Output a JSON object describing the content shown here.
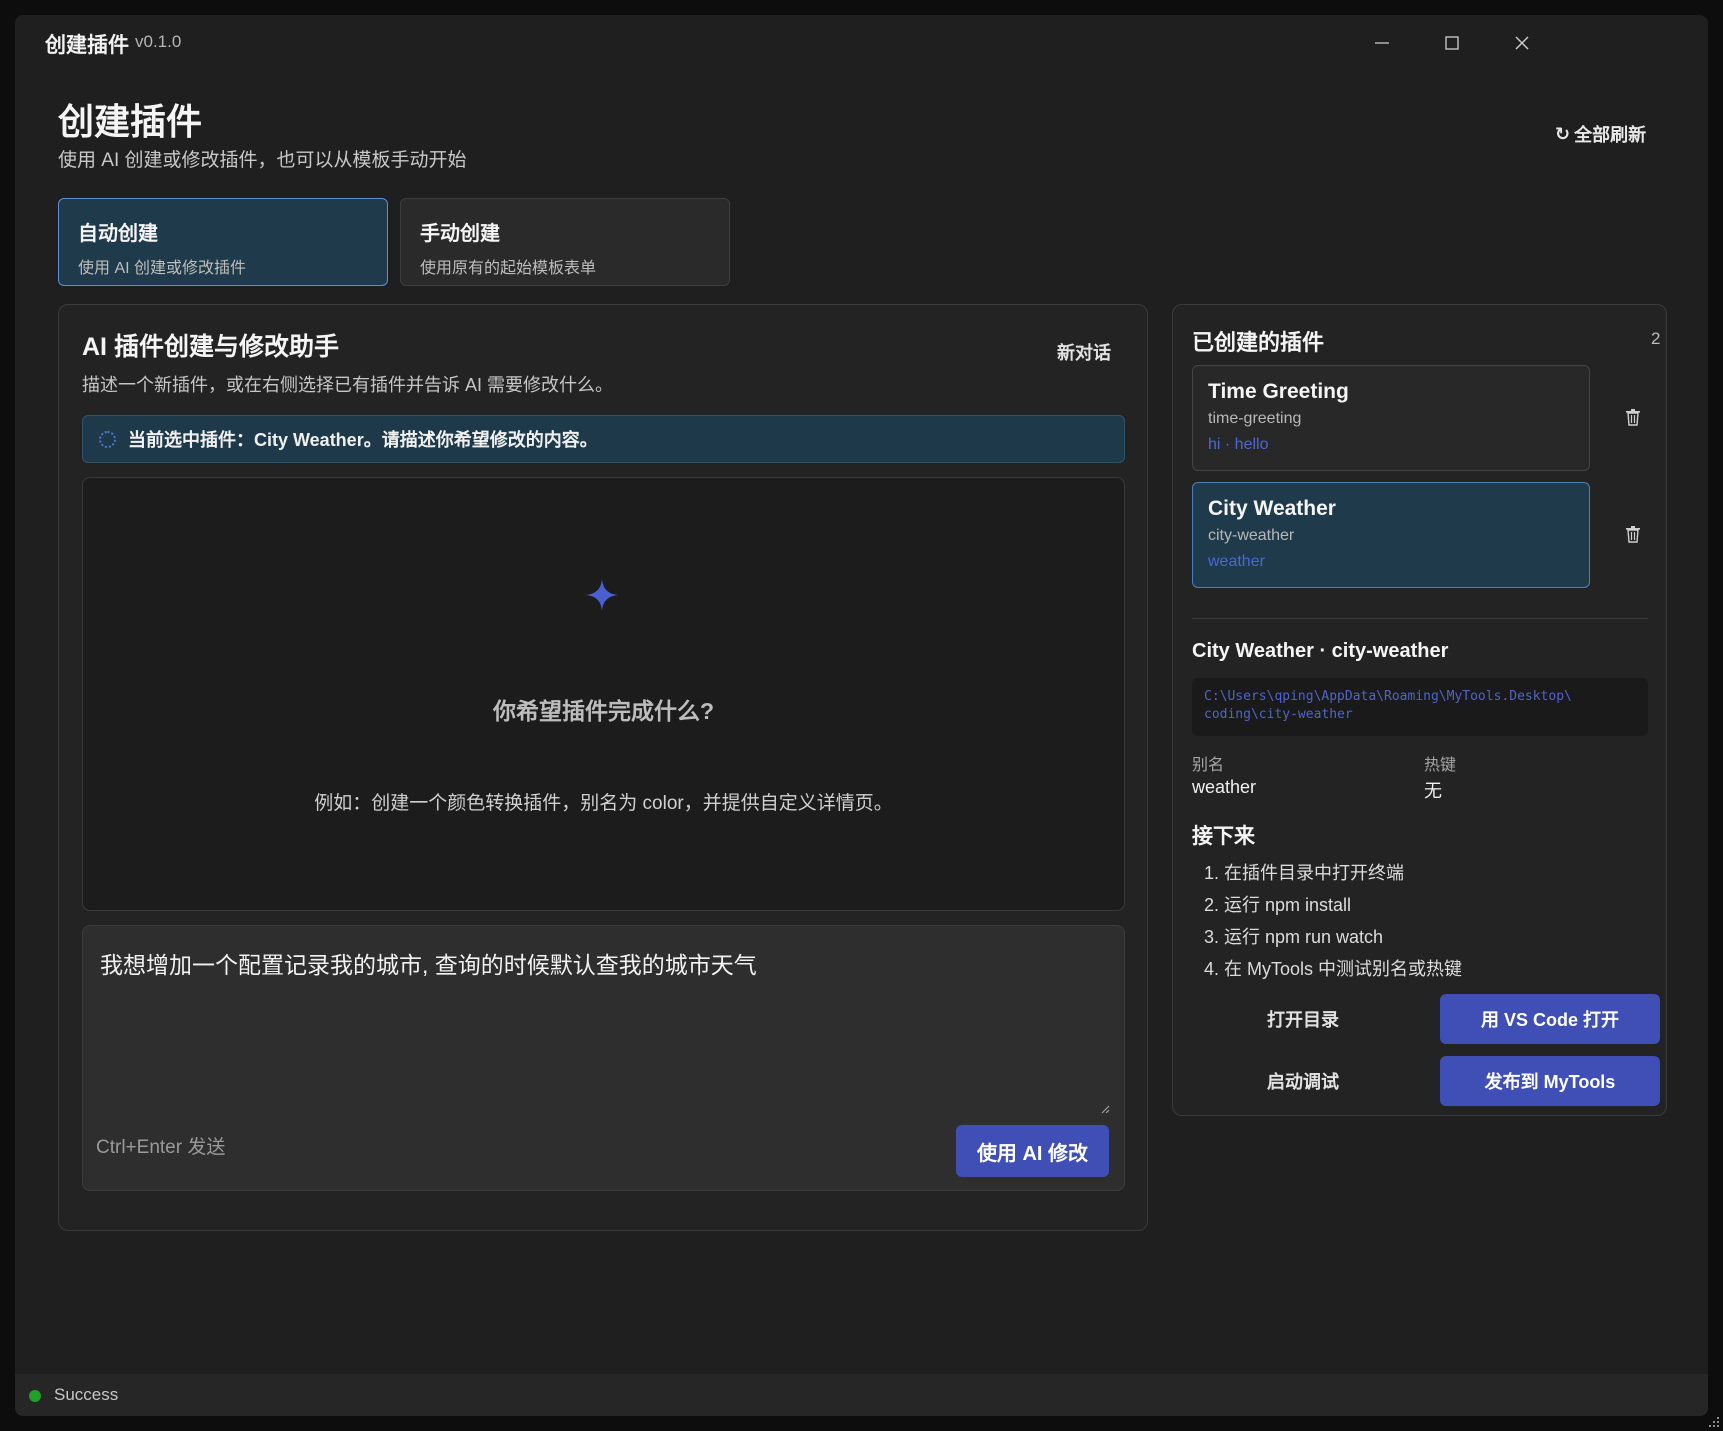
{
  "window": {
    "app_name": "创建插件",
    "version": "v0.1.0",
    "controls": [
      "minimize-icon",
      "maximize-icon",
      "close-icon"
    ]
  },
  "header": {
    "title": "创建插件",
    "subtitle": "使用 AI 创建或修改插件，也可以从模板手动开始",
    "refresh_icon": "↻",
    "refresh_label": "全部刷新"
  },
  "modes": [
    {
      "title": "自动创建",
      "desc": "使用 AI 创建或修改插件",
      "active": true
    },
    {
      "title": "手动创建",
      "desc": "使用原有的起始模板表单",
      "active": false
    }
  ],
  "assistant": {
    "title": "AI 插件创建与修改助手",
    "subtitle": "描述一个新插件，或在右侧选择已有插件并告诉 AI 需要修改什么。",
    "new_chat_label": "新对话",
    "banner": "当前选中插件：City Weather。请描述你希望修改的内容。",
    "empty_question": "你希望插件完成什么?",
    "empty_example": "例如：创建一个颜色转换插件，别名为 color，并提供自定义详情页。",
    "input_value": "我想增加一个配置记录我的城市, 查询的时候默认查我的城市天气",
    "hint": "Ctrl+Enter 发送",
    "submit_label": "使用 AI 修改"
  },
  "plugins": {
    "title": "已创建的插件",
    "count": "2",
    "items": [
      {
        "name": "Time Greeting",
        "id": "time-greeting",
        "aliases": "hi · hello",
        "selected": false
      },
      {
        "name": "City Weather",
        "id": "city-weather",
        "aliases": "weather",
        "selected": true
      }
    ]
  },
  "detail": {
    "title": "City Weather · city-weather",
    "path_line1": "C:\\Users\\qping\\AppData\\Roaming\\MyTools.Desktop\\",
    "path_line2": "coding\\city-weather",
    "alias_label": "别名",
    "alias_value": "weather",
    "hotkey_label": "热键",
    "hotkey_value": "无",
    "next_title": "接下来",
    "steps": [
      "1. 在插件目录中打开终端",
      "2. 运行 npm install",
      "3. 运行 npm run watch",
      "4. 在 MyTools 中测试别名或热键"
    ],
    "open_dir_label": "打开目录",
    "vscode_label": "用 VS Code 打开",
    "debug_label": "启动调试",
    "publish_label": "发布到 MyTools"
  },
  "status": {
    "text": "Success",
    "color": "#1fa02a"
  },
  "colors": {
    "accent": "#3f4fb5",
    "selected_bg": "#1f3a4a",
    "alias_link": "#4a66d8"
  }
}
